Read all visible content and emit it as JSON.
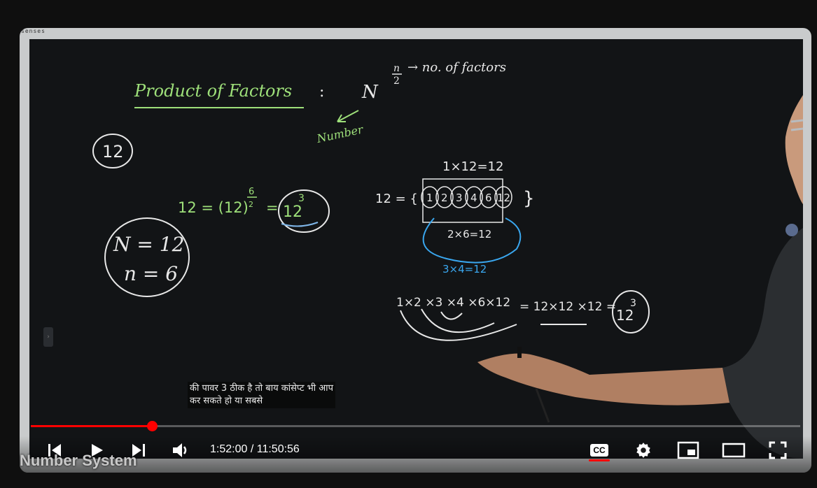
{
  "player": {
    "brand": "senses",
    "current_time": "1:52:00",
    "duration": "11:50:56",
    "time_separator": " / ",
    "progress_fraction": 0.157,
    "watermark": "Number System",
    "caption_line1": "की पावर 3 ठीक है तो बाय कांसेप्ट भी आप",
    "caption_line2": "कर सकते हो या सबसे",
    "accent_color": "#ff0000"
  },
  "controls": {
    "previous_icon": "skip-previous-icon",
    "play_icon": "play-icon",
    "next_icon": "skip-next-icon",
    "volume_icon": "volume-icon",
    "cc_label": "CC",
    "settings_icon": "gear-icon",
    "miniplayer_icon": "miniplayer-icon",
    "theater_icon": "theater-mode-icon",
    "fullscreen_icon": "fullscreen-icon"
  },
  "board": {
    "title": "Product of Factors",
    "colon": ":",
    "formula_base": "N",
    "formula_exp_num": "n",
    "formula_exp_den": "2",
    "exp_note": "→ no. of factors",
    "number_note": "Number",
    "circled_number": "12",
    "eq1_lhs": "12 = (12)",
    "eq1_exp_num": "6",
    "eq1_exp_den": "2",
    "eq1_eq": "=",
    "eq1_result": "12",
    "eq1_result_exp": "3",
    "given_n": "N = 12",
    "given_small_n": "n = 6",
    "set_lhs": "12 = {",
    "set_items": [
      "1",
      "2",
      "3",
      "4",
      "6",
      "12"
    ],
    "set_close": "}",
    "pair1": "1×12=12",
    "pair2": "2×6=12",
    "pair3": "3×4=12",
    "product_lhs": "1×2 ×3 ×4 ×6×12",
    "product_mid": "= 12×12 ×12 =",
    "product_result": "12",
    "product_result_exp": "3"
  }
}
